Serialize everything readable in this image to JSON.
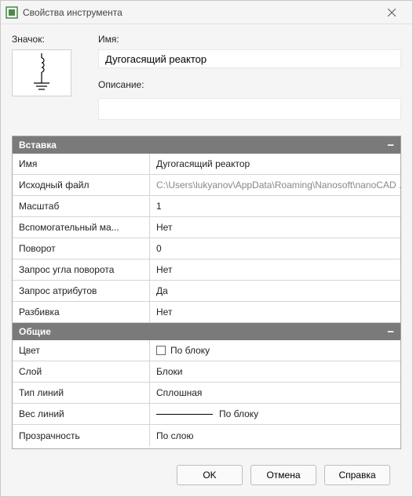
{
  "window": {
    "title": "Свойства инструмента"
  },
  "top": {
    "icon_label": "Значок:",
    "name_label": "Имя:",
    "name_value": "Дугогасящий реактор",
    "desc_label": "Описание:",
    "desc_value": ""
  },
  "sections": {
    "insert": {
      "title": "Вставка",
      "rows": {
        "name": {
          "label": "Имя",
          "value": "Дугогасящий реактор"
        },
        "source": {
          "label": "Исходный файл",
          "value": "C:\\Users\\lukyanov\\AppData\\Roaming\\Nanosoft\\nanoCAD ..."
        },
        "scale": {
          "label": "Масштаб",
          "value": "1"
        },
        "aux_scale": {
          "label": "Вспомогательный ма...",
          "value": "Нет"
        },
        "rotation": {
          "label": "Поворот",
          "value": "0"
        },
        "ask_rotation": {
          "label": "Запрос угла поворота",
          "value": "Нет"
        },
        "ask_attrs": {
          "label": "Запрос атрибутов",
          "value": "Да"
        },
        "explode": {
          "label": "Разбивка",
          "value": "Нет"
        }
      }
    },
    "general": {
      "title": "Общие",
      "rows": {
        "color": {
          "label": "Цвет",
          "value": "По блоку"
        },
        "layer": {
          "label": "Слой",
          "value": "Блоки"
        },
        "linetype": {
          "label": "Тип линий",
          "value": "Сплошная"
        },
        "lineweight": {
          "label": "Вес линий",
          "value": "По блоку"
        },
        "transparency": {
          "label": "Прозрачность",
          "value": "По слою"
        }
      }
    }
  },
  "buttons": {
    "ok": "OK",
    "cancel": "Отмена",
    "help": "Справка"
  }
}
